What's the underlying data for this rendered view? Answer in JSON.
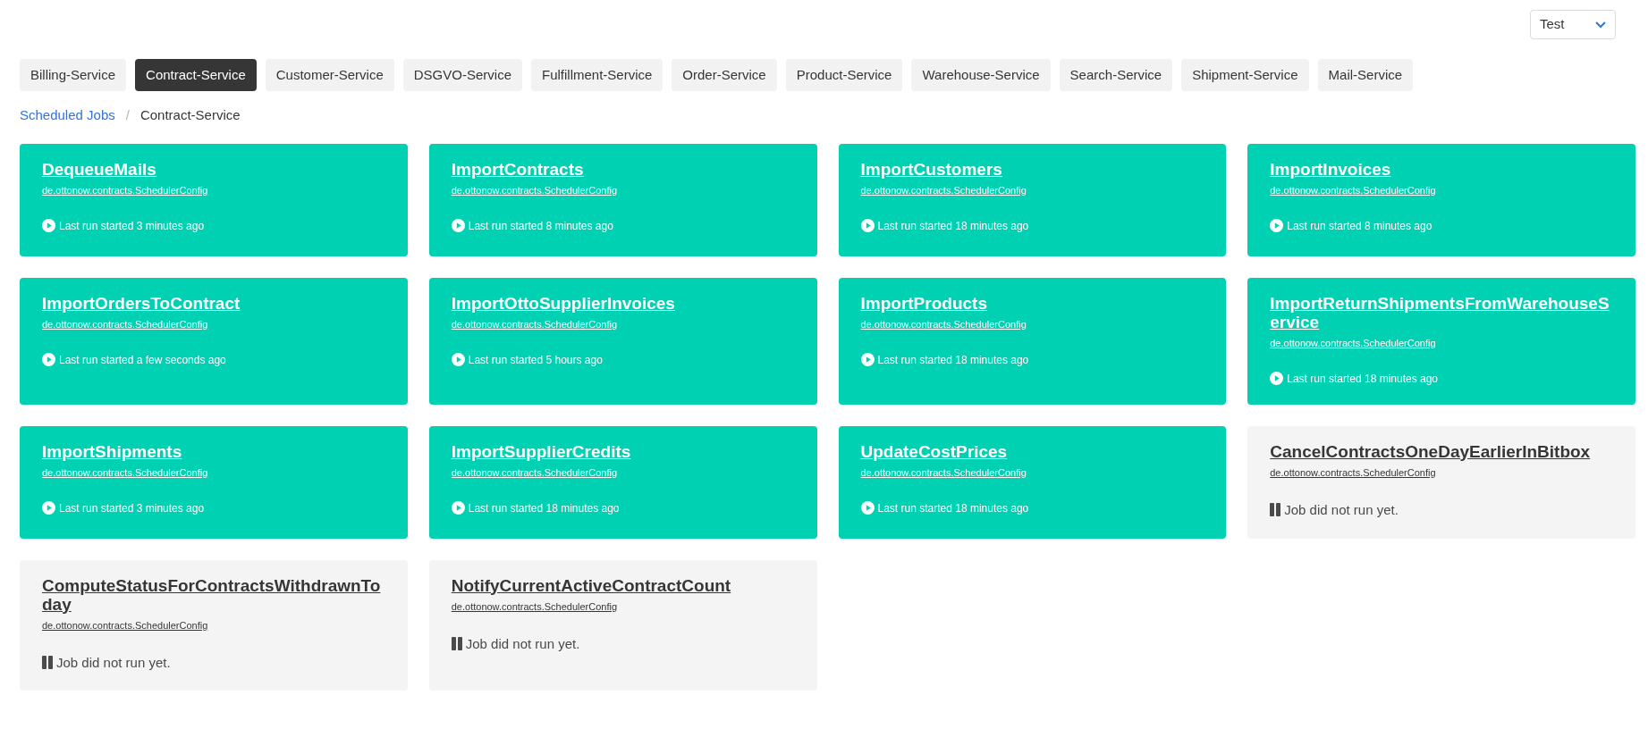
{
  "environment_select": {
    "value": "Test"
  },
  "service_tabs": [
    {
      "label": "Billing-Service",
      "selected": false
    },
    {
      "label": "Contract-Service",
      "selected": true
    },
    {
      "label": "Customer-Service",
      "selected": false
    },
    {
      "label": "DSGVO-Service",
      "selected": false
    },
    {
      "label": "Fulfillment-Service",
      "selected": false
    },
    {
      "label": "Order-Service",
      "selected": false
    },
    {
      "label": "Product-Service",
      "selected": false
    },
    {
      "label": "Warehouse-Service",
      "selected": false
    },
    {
      "label": "Search-Service",
      "selected": false
    },
    {
      "label": "Shipment-Service",
      "selected": false
    },
    {
      "label": "Mail-Service",
      "selected": false
    }
  ],
  "breadcrumb": {
    "link": "Scheduled Jobs",
    "separator": "/",
    "current": "Contract-Service"
  },
  "jobs": [
    {
      "name": "DequeueMails",
      "config": "de.ottonow.contracts.SchedulerConfig",
      "kind": "ran",
      "status": "Last run started 3 minutes ago"
    },
    {
      "name": "ImportContracts",
      "config": "de.ottonow.contracts.SchedulerConfig",
      "kind": "ran",
      "status": "Last run started 8 minutes ago"
    },
    {
      "name": "ImportCustomers",
      "config": "de.ottonow.contracts.SchedulerConfig",
      "kind": "ran",
      "status": "Last run started 18 minutes ago"
    },
    {
      "name": "ImportInvoices",
      "config": "de.ottonow.contracts.SchedulerConfig",
      "kind": "ran",
      "status": "Last run started 8 minutes ago"
    },
    {
      "name": "ImportOrdersToContract",
      "config": "de.ottonow.contracts.SchedulerConfig",
      "kind": "ran",
      "status": "Last run started a few seconds ago"
    },
    {
      "name": "ImportOttoSupplierInvoices",
      "config": "de.ottonow.contracts.SchedulerConfig",
      "kind": "ran",
      "status": "Last run started 5 hours ago"
    },
    {
      "name": "ImportProducts",
      "config": "de.ottonow.contracts.SchedulerConfig",
      "kind": "ran",
      "status": "Last run started 18 minutes ago"
    },
    {
      "name": "ImportReturnShipmentsFromWarehouseService",
      "config": "de.ottonow.contracts.SchedulerConfig",
      "kind": "ran",
      "status": "Last run started 18 minutes ago"
    },
    {
      "name": "ImportShipments",
      "config": "de.ottonow.contracts.SchedulerConfig",
      "kind": "ran",
      "status": "Last run started 3 minutes ago"
    },
    {
      "name": "ImportSupplierCredits",
      "config": "de.ottonow.contracts.SchedulerConfig",
      "kind": "ran",
      "status": "Last run started 18 minutes ago"
    },
    {
      "name": "UpdateCostPrices",
      "config": "de.ottonow.contracts.SchedulerConfig",
      "kind": "ran",
      "status": "Last run started 18 minutes ago"
    },
    {
      "name": "CancelContractsOneDayEarlierInBitbox",
      "config": "de.ottonow.contracts.SchedulerConfig",
      "kind": "not_run",
      "status": "Job did not run yet."
    },
    {
      "name": "ComputeStatusForContractsWithdrawnToday",
      "config": "de.ottonow.contracts.SchedulerConfig",
      "kind": "not_run",
      "status": "Job did not run yet."
    },
    {
      "name": "NotifyCurrentActiveContractCount",
      "config": "de.ottonow.contracts.SchedulerConfig",
      "kind": "not_run",
      "status": "Job did not run yet."
    }
  ]
}
